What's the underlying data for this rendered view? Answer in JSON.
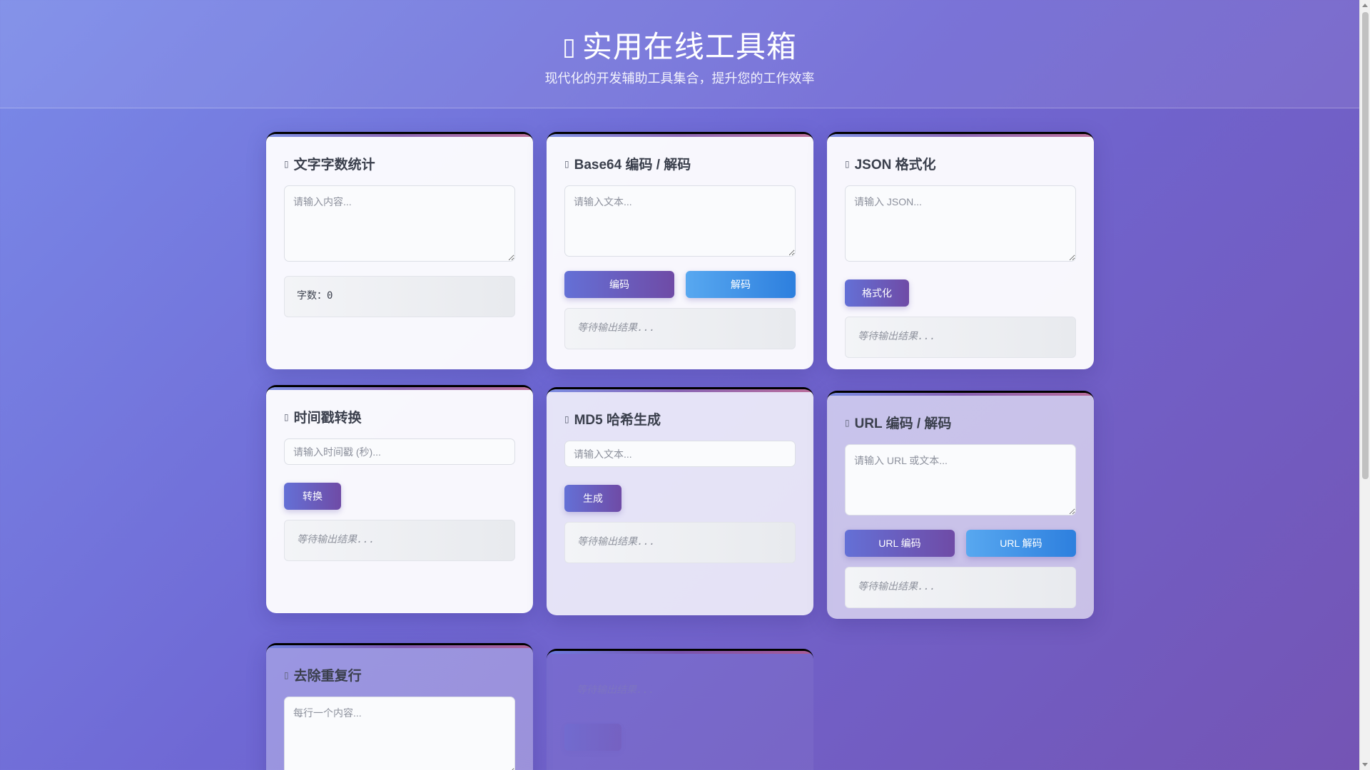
{
  "header": {
    "logo_icon": "toolbox-icon",
    "logo_glyph": "▯",
    "title": "实用在线工具箱",
    "subtitle": "现代化的开发辅助工具集合，提升您的工作效率"
  },
  "tools": {
    "word_count": {
      "title": "文字字数统计",
      "placeholder": "请输入内容...",
      "count_label": "字数：",
      "count_value": "0"
    },
    "base64": {
      "title": "Base64 编码 / 解码",
      "placeholder": "请输入文本...",
      "encode_label": "编码",
      "decode_label": "解码",
      "output": "等待输出结果..."
    },
    "json": {
      "title": "JSON 格式化",
      "placeholder": "请输入 JSON...",
      "format_label": "格式化",
      "output": "等待输出结果..."
    },
    "timestamp": {
      "title": "时间戳转换",
      "placeholder": "请输入时间戳 (秒)...",
      "convert_label": "转换",
      "output": "等待输出结果..."
    },
    "md5": {
      "title": "MD5 哈希生成",
      "placeholder": "请输入文本...",
      "generate_label": "生成",
      "output": "等待输出结果..."
    },
    "url": {
      "title": "URL 编码 / 解码",
      "placeholder": "请输入 URL 或文本...",
      "encode_label": "URL 编码",
      "decode_label": "URL 解码",
      "output": "等待输出结果..."
    },
    "dedupe": {
      "title": "去除重复行",
      "placeholder": "每行一个内容..."
    },
    "faded": {
      "output": "等待输出结果..."
    }
  },
  "icon_glyph": "▯",
  "colors": {
    "accent_start": "#6470d6",
    "accent_end": "#6f4ba6",
    "blue_start": "#58a8f0",
    "blue_end": "#2d7fde"
  }
}
